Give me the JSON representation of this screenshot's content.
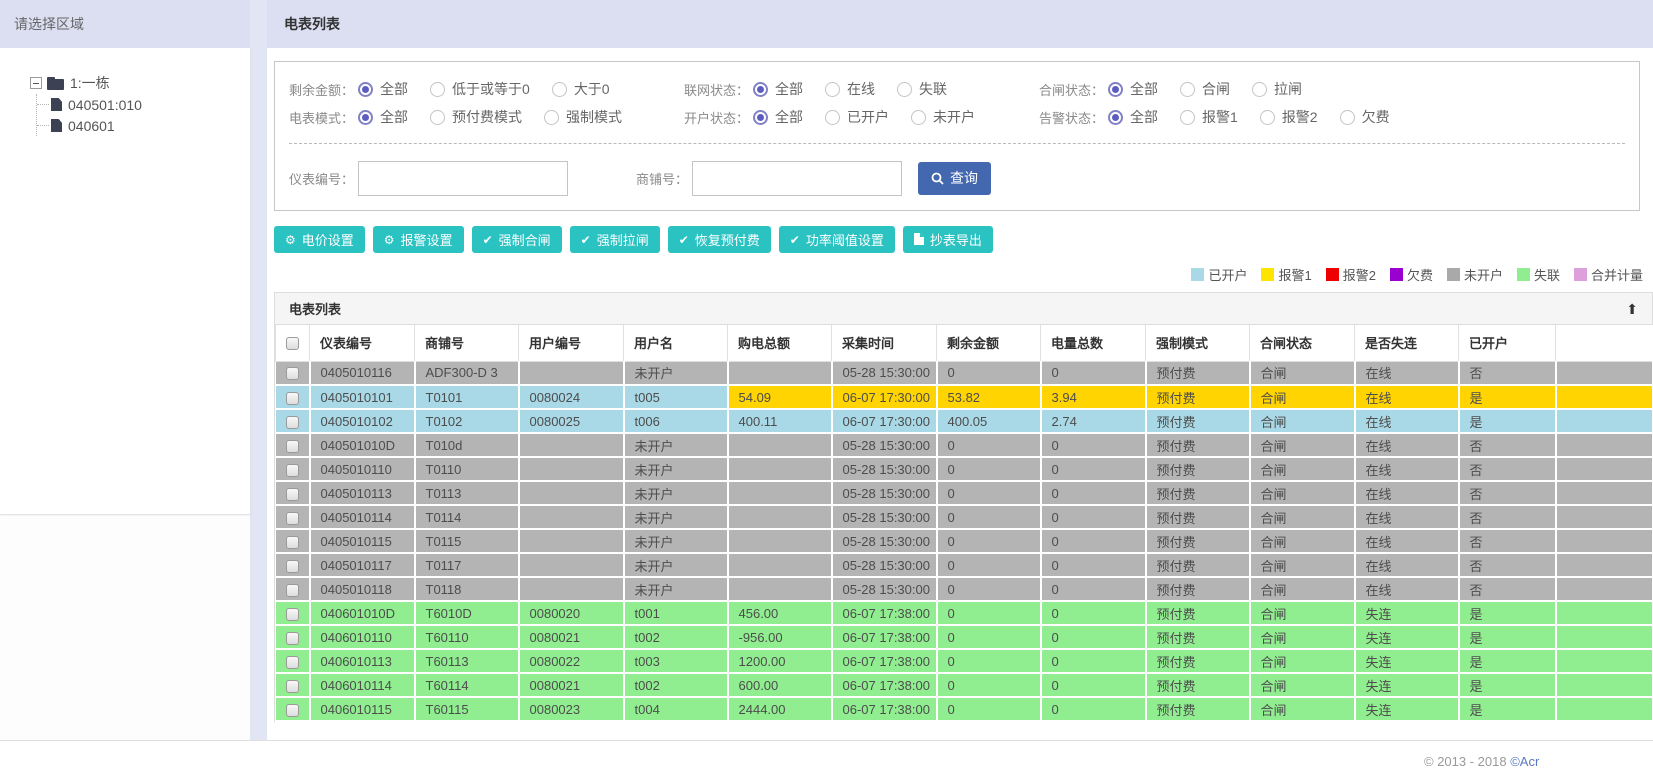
{
  "sidebar": {
    "title": "请选择区域",
    "tree": {
      "root_label": "1:一栋",
      "children": [
        "040501:010",
        "040601"
      ]
    }
  },
  "main": {
    "title": "电表列表",
    "filter_rows": [
      [
        {
          "label": "剩余金额：",
          "options": [
            "全部",
            "低于或等于0",
            "大于0"
          ],
          "selected": 0
        },
        {
          "label": "联网状态：",
          "options": [
            "全部",
            "在线",
            "失联"
          ],
          "selected": 0
        },
        {
          "label": "合闸状态：",
          "options": [
            "全部",
            "合闸",
            "拉闸"
          ],
          "selected": 0
        }
      ],
      [
        {
          "label": "电表模式：",
          "options": [
            "全部",
            "预付费模式",
            "强制模式"
          ],
          "selected": 0
        },
        {
          "label": "开户状态：",
          "options": [
            "全部",
            "已开户",
            "未开户"
          ],
          "selected": 0
        },
        {
          "label": "告警状态：",
          "options": [
            "全部",
            "报警1",
            "报警2",
            "欠费"
          ],
          "selected": 0
        }
      ]
    ],
    "search": {
      "meter_label": "仪表编号：",
      "meter_value": "",
      "shop_label": "商铺号：",
      "shop_value": "",
      "query_label": "查询"
    },
    "actions": [
      {
        "label": "电价设置",
        "icon": "gear"
      },
      {
        "label": "报警设置",
        "icon": "gear"
      },
      {
        "label": "强制合闸",
        "icon": "check"
      },
      {
        "label": "强制拉闸",
        "icon": "check"
      },
      {
        "label": "恢复预付费",
        "icon": "check"
      },
      {
        "label": "功率阈值设置",
        "icon": "check"
      },
      {
        "label": "抄表导出",
        "icon": "file"
      }
    ],
    "legend": [
      {
        "label": "已开户",
        "color": "#a9d8e6"
      },
      {
        "label": "报警1",
        "color": "#ffe400"
      },
      {
        "label": "报警2",
        "color": "#ee0000"
      },
      {
        "label": "欠费",
        "color": "#9a00d0"
      },
      {
        "label": "未开户",
        "color": "#a9a9a9"
      },
      {
        "label": "失联",
        "color": "#90ee90"
      },
      {
        "label": "合并计量",
        "color": "#dda0dd"
      }
    ],
    "table": {
      "title": "电表列表",
      "collapse_icon": "⬆",
      "columns": [
        "仪表编号",
        "商铺号",
        "用户编号",
        "用户名",
        "购电总额",
        "采集时间",
        "剩余金额",
        "电量总数",
        "强制模式",
        "合闸状态",
        "是否失连",
        "已开户"
      ],
      "rows": [
        {
          "style": "gray",
          "yellow_from": -1,
          "cells": [
            "0405010116",
            "ADF300-D 3",
            "",
            "未开户",
            "",
            "05-28 15:30:00",
            "0",
            "0",
            "预付费",
            "合闸",
            "在线",
            "否"
          ]
        },
        {
          "style": "blue",
          "yellow_from": 4,
          "cells": [
            "0405010101",
            "T0101",
            "0080024",
            "t005",
            "54.09",
            "06-07 17:30:00",
            "53.82",
            "3.94",
            "预付费",
            "合闸",
            "在线",
            "是"
          ]
        },
        {
          "style": "blue",
          "yellow_from": -1,
          "cells": [
            "0405010102",
            "T0102",
            "0080025",
            "t006",
            "400.11",
            "06-07 17:30:00",
            "400.05",
            "2.74",
            "预付费",
            "合闸",
            "在线",
            "是"
          ]
        },
        {
          "style": "gray",
          "yellow_from": -1,
          "cells": [
            "040501010D",
            "T010d",
            "",
            "未开户",
            "",
            "05-28 15:30:00",
            "0",
            "0",
            "预付费",
            "合闸",
            "在线",
            "否"
          ]
        },
        {
          "style": "gray",
          "yellow_from": -1,
          "cells": [
            "0405010110",
            "T0110",
            "",
            "未开户",
            "",
            "05-28 15:30:00",
            "0",
            "0",
            "预付费",
            "合闸",
            "在线",
            "否"
          ]
        },
        {
          "style": "gray",
          "yellow_from": -1,
          "cells": [
            "0405010113",
            "T0113",
            "",
            "未开户",
            "",
            "05-28 15:30:00",
            "0",
            "0",
            "预付费",
            "合闸",
            "在线",
            "否"
          ]
        },
        {
          "style": "gray",
          "yellow_from": -1,
          "cells": [
            "0405010114",
            "T0114",
            "",
            "未开户",
            "",
            "05-28 15:30:00",
            "0",
            "0",
            "预付费",
            "合闸",
            "在线",
            "否"
          ]
        },
        {
          "style": "gray",
          "yellow_from": -1,
          "cells": [
            "0405010115",
            "T0115",
            "",
            "未开户",
            "",
            "05-28 15:30:00",
            "0",
            "0",
            "预付费",
            "合闸",
            "在线",
            "否"
          ]
        },
        {
          "style": "gray",
          "yellow_from": -1,
          "cells": [
            "0405010117",
            "T0117",
            "",
            "未开户",
            "",
            "05-28 15:30:00",
            "0",
            "0",
            "预付费",
            "合闸",
            "在线",
            "否"
          ]
        },
        {
          "style": "gray",
          "yellow_from": -1,
          "cells": [
            "0405010118",
            "T0118",
            "",
            "未开户",
            "",
            "05-28 15:30:00",
            "0",
            "0",
            "预付费",
            "合闸",
            "在线",
            "否"
          ]
        },
        {
          "style": "green",
          "yellow_from": -1,
          "cells": [
            "040601010D",
            "T6010D",
            "0080020",
            "t001",
            "456.00",
            "06-07 17:38:00",
            "0",
            "0",
            "预付费",
            "合闸",
            "失连",
            "是"
          ]
        },
        {
          "style": "green",
          "yellow_from": -1,
          "cells": [
            "0406010110",
            "T60110",
            "0080021",
            "t002",
            "-956.00",
            "06-07 17:38:00",
            "0",
            "0",
            "预付费",
            "合闸",
            "失连",
            "是"
          ]
        },
        {
          "style": "green",
          "yellow_from": -1,
          "cells": [
            "0406010113",
            "T60113",
            "0080022",
            "t003",
            "1200.00",
            "06-07 17:38:00",
            "0",
            "0",
            "预付费",
            "合闸",
            "失连",
            "是"
          ]
        },
        {
          "style": "green",
          "yellow_from": -1,
          "cells": [
            "0406010114",
            "T60114",
            "0080021",
            "t002",
            "600.00",
            "06-07 17:38:00",
            "0",
            "0",
            "预付费",
            "合闸",
            "失连",
            "是"
          ]
        },
        {
          "style": "green",
          "yellow_from": -1,
          "cells": [
            "0406010115",
            "T60115",
            "0080023",
            "t004",
            "2444.00",
            "06-07 17:38:00",
            "0",
            "0",
            "预付费",
            "合闸",
            "失连",
            "是"
          ]
        }
      ]
    }
  },
  "footer": {
    "copyright_prefix": "© 2013 - 2018 ",
    "copyright_link": "©Acr"
  }
}
